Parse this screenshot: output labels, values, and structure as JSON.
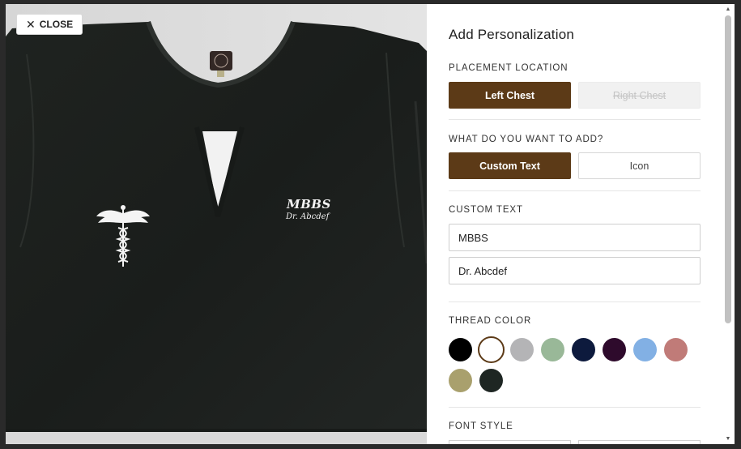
{
  "close_label": "CLOSE",
  "preview": {
    "text_line1": "MBBS",
    "text_line2": "Dr. Abcdef",
    "tag_text": "TCE"
  },
  "panel": {
    "title": "Add Personalization",
    "placement": {
      "label": "PLACEMENT LOCATION",
      "options": [
        "Left Chest",
        "Right Chest"
      ],
      "selected": "Left Chest",
      "disabled": [
        "Right Chest"
      ]
    },
    "add_type": {
      "label": "WHAT DO YOU WANT TO ADD?",
      "options": [
        "Custom Text",
        "Icon"
      ],
      "selected": "Custom Text"
    },
    "custom_text": {
      "label": "CUSTOM TEXT",
      "line1": "MBBS",
      "line2": "Dr. Abcdef"
    },
    "thread_color": {
      "label": "THREAD COLOR",
      "colors": [
        "#000000",
        "#ffffff",
        "#b4b4b6",
        "#99b898",
        "#0d1a3d",
        "#2e0a2c",
        "#82b0e4",
        "#c07b78",
        "#a9a06d",
        "#1e2623"
      ],
      "selected_index": 1
    },
    "font_style": {
      "label": "FONT STYLE"
    }
  },
  "colors": {
    "accent": "#5c3a17",
    "shirt": "#1c1f1d"
  }
}
